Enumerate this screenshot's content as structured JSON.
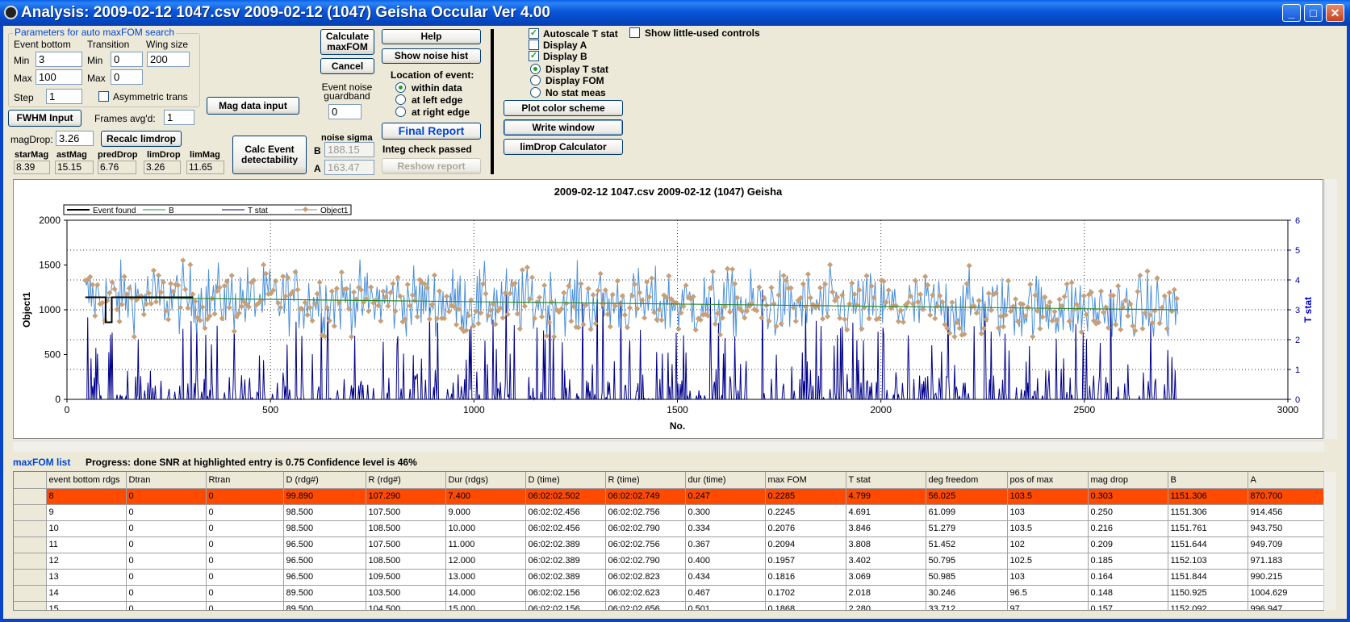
{
  "window": {
    "title": "Analysis: 2009-02-12 1047.csv 2009-02-12 (1047) Geisha  Occular Ver 4.00"
  },
  "params": {
    "group_title": "Parameters for auto maxFOM search",
    "event_bottom_label": "Event bottom",
    "transition_label": "Transition",
    "wing_label": "Wing size",
    "min_label": "Min",
    "max_label": "Max",
    "step_label": "Step",
    "eb_min": "3",
    "eb_max": "100",
    "step": "1",
    "tr_min": "0",
    "tr_max": "0",
    "wing": "200",
    "asym_label": "Asymmetric trans"
  },
  "controls": {
    "mag_data_input": "Mag data input",
    "fwhm_input": "FWHM Input",
    "frames_label": "Frames avg'd:",
    "frames_value": "1",
    "magdrop_label": "magDrop:",
    "magdrop_value": "3.26",
    "recalc_limdrop": "Recalc limdrop",
    "calc_event": "Calc Event detectability",
    "calc_maxfom": "Calculate maxFOM",
    "cancel": "Cancel",
    "guardband_label": "Event noise guardband",
    "guardband_value": "0",
    "help": "Help",
    "noise_hist": "Show noise hist",
    "location_label": "Location of event:",
    "loc_within": "within data",
    "loc_left": "at left edge",
    "loc_right": "at right edge",
    "final_report": "Final Report",
    "integ_check": "Integ check passed",
    "reshow_report": "Reshow report",
    "noise_sigma_label": "noise sigma",
    "noise_b_label": "B",
    "noise_b": "188.15",
    "noise_a_label": "A",
    "noise_a": "163.47",
    "autoscale": "Autoscale T stat",
    "display_a": "Display A",
    "display_b": "Display B",
    "little_used": "Show little-used controls",
    "display_tstat": "Display T stat",
    "display_fom": "Display FOM",
    "no_stat": "No stat meas",
    "plot_color": "Plot color scheme",
    "write_window": "Write window",
    "limdrop_calc": "limDrop Calculator",
    "mags": [
      {
        "label": "starMag",
        "value": "8.39"
      },
      {
        "label": "astMag",
        "value": "15.15"
      },
      {
        "label": "predDrop",
        "value": "6.76"
      },
      {
        "label": "limDrop",
        "value": "3.26"
      },
      {
        "label": "limMag",
        "value": "11.65"
      }
    ]
  },
  "chart_data": {
    "type": "line",
    "title": "2009-02-12 1047.csv 2009-02-12 (1047) Geisha",
    "xlabel": "No.",
    "ylabel": "Object1",
    "y2label": "T stat",
    "xlim": [
      0,
      3000
    ],
    "ylim": [
      0,
      2000
    ],
    "y2lim": [
      0,
      6
    ],
    "xticks": [
      "0",
      "500",
      "1000",
      "1500",
      "2000",
      "2500",
      "3000"
    ],
    "yticks": [
      "0",
      "500",
      "1000",
      "1500",
      "2000"
    ],
    "y2ticks": [
      "0",
      "1",
      "2",
      "3",
      "4",
      "5",
      "6"
    ],
    "legend": [
      "Event found",
      "B",
      "T stat",
      "Object1"
    ],
    "legend_position": "top-left",
    "grid": true,
    "colors": {
      "object1": "#4A90D9",
      "marker": "#C8A078",
      "tstat": "#00008B",
      "b": "#2E8B2E",
      "event": "#000000"
    },
    "x_range_data": [
      45,
      2730
    ],
    "event_found": {
      "x_start": 45,
      "x_end": 310,
      "level": 1140,
      "bottom_x": [
        95,
        110
      ],
      "bottom_level": 860
    },
    "b_line": {
      "x": [
        45,
        2730
      ],
      "y": [
        1140,
        1000
      ]
    },
    "object1_mean": 1100,
    "object1_sigma": 185
  },
  "status": {
    "maxfom_list_label": "maxFOM list",
    "progress": "Progress: done  SNR at highlighted entry is 0.75   Confidence level is 46%"
  },
  "table": {
    "columns": [
      "event bottom rdgs",
      "Dtran",
      "Rtran",
      "D (rdg#)",
      "R (rdg#)",
      "Dur (rdgs)",
      "D (time)",
      "R (time)",
      "dur (time)",
      "max FOM",
      "T stat",
      "deg freedom",
      "pos of max",
      "mag drop",
      "B",
      "A"
    ],
    "rows": [
      [
        "8",
        "0",
        "0",
        "99.890",
        "107.290",
        "7.400",
        "06:02:02.502",
        "06:02:02.749",
        "0.247",
        "0.2285",
        "4.799",
        "56.025",
        "103.5",
        "0.303",
        "1151.306",
        "870.700"
      ],
      [
        "9",
        "0",
        "0",
        "98.500",
        "107.500",
        "9.000",
        "06:02:02.456",
        "06:02:02.756",
        "0.300",
        "0.2245",
        "4.691",
        "61.099",
        "103",
        "0.250",
        "1151.306",
        "914.456"
      ],
      [
        "10",
        "0",
        "0",
        "98.500",
        "108.500",
        "10.000",
        "06:02:02.456",
        "06:02:02.790",
        "0.334",
        "0.2076",
        "3.846",
        "51.279",
        "103.5",
        "0.216",
        "1151.761",
        "943.750"
      ],
      [
        "11",
        "0",
        "0",
        "96.500",
        "107.500",
        "11.000",
        "06:02:02.389",
        "06:02:02.756",
        "0.367",
        "0.2094",
        "3.808",
        "51.452",
        "102",
        "0.209",
        "1151.644",
        "949.709"
      ],
      [
        "12",
        "0",
        "0",
        "96.500",
        "108.500",
        "12.000",
        "06:02:02.389",
        "06:02:02.790",
        "0.400",
        "0.1957",
        "3.402",
        "50.795",
        "102.5",
        "0.185",
        "1152.103",
        "971.183"
      ],
      [
        "13",
        "0",
        "0",
        "96.500",
        "109.500",
        "13.000",
        "06:02:02.389",
        "06:02:02.823",
        "0.434",
        "0.1816",
        "3.069",
        "50.985",
        "103",
        "0.164",
        "1151.844",
        "990.215"
      ],
      [
        "14",
        "0",
        "0",
        "89.500",
        "103.500",
        "14.000",
        "06:02:02.156",
        "06:02:02.623",
        "0.467",
        "0.1702",
        "2.018",
        "30.246",
        "96.5",
        "0.148",
        "1150.925",
        "1004.629"
      ],
      [
        "15",
        "0",
        "0",
        "89.500",
        "104.500",
        "15.000",
        "06:02:02.156",
        "06:02:02.656",
        "0.501",
        "0.1868",
        "2.280",
        "33.712",
        "97",
        "0.157",
        "1152.092",
        "996.947"
      ]
    ]
  }
}
